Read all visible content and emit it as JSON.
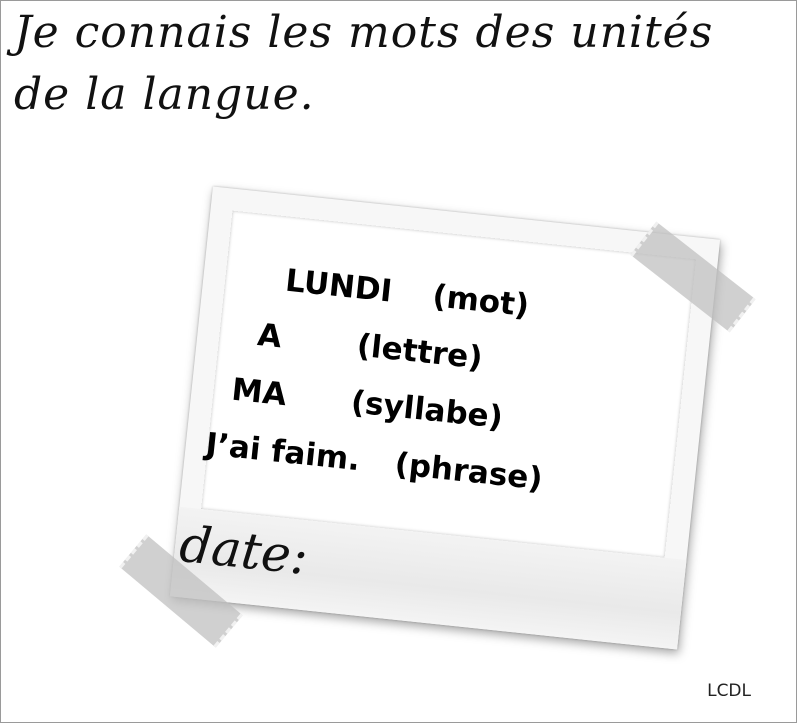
{
  "heading": {
    "line1": "Je connais les mots des unités",
    "line2": "de la langue."
  },
  "card": {
    "items": [
      {
        "word": "LUNDI",
        "category": "(mot)"
      },
      {
        "word": "A",
        "category": "(lettre)"
      },
      {
        "word": "MA",
        "category": "(syllabe)"
      },
      {
        "word": "J’ai faim.",
        "category": "(phrase)"
      }
    ],
    "date_label": "date:"
  },
  "credit": "LCDL"
}
